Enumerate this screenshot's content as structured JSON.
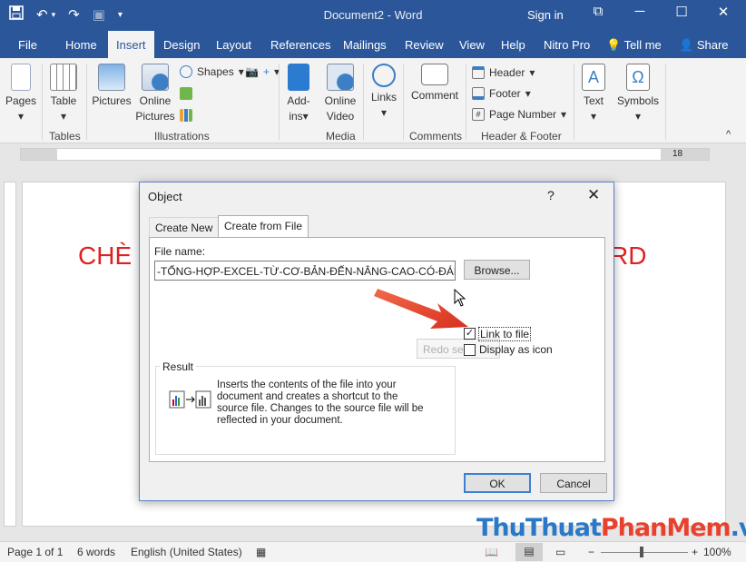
{
  "titlebar": {
    "title": "Document2 - Word",
    "sign_in": "Sign in"
  },
  "tabs": {
    "items": [
      "File",
      "Home",
      "Insert",
      "Design",
      "Layout",
      "References",
      "Mailings",
      "Review",
      "View",
      "Help",
      "Nitro Pro"
    ],
    "active": "Insert",
    "tell_me": "Tell me",
    "share": "Share"
  },
  "ribbon": {
    "pages": "Pages",
    "table": "Table",
    "pictures": "Pictures",
    "online_pictures_1": "Online",
    "online_pictures_2": "Pictures",
    "shapes": "Shapes",
    "addins_1": "Add-",
    "addins_2": "ins",
    "online_video_1": "Online",
    "online_video_2": "Video",
    "links": "Links",
    "comment": "Comment",
    "header": "Header",
    "footer": "Footer",
    "page_number": "Page Number",
    "text": "Text",
    "symbols": "Symbols",
    "groups": {
      "tables": "Tables",
      "illustrations": "Illustrations",
      "media": "Media",
      "comments": "Comments",
      "header_footer": "Header & Footer"
    }
  },
  "ruler": {
    "label": "18"
  },
  "document": {
    "heading_left": "CHÈ",
    "heading_right": "RD"
  },
  "dialog": {
    "title": "Object",
    "help": "?",
    "tab_create_new": "Create New",
    "tab_create_from_file": "Create from File",
    "file_name_label": "File name:",
    "file_name_value": "-TỔNG-HỢP-EXCEL-TỪ-CƠ-BẢN-ĐẾN-NÂNG-CAO-CÓ-ĐÁP-ÁN.xls",
    "browse": "Browse...",
    "ghost_text": "Redo se",
    "link_to_file": "Link to file",
    "link_to_file_checked": true,
    "display_as_icon": "Display as icon",
    "result_label": "Result",
    "result_text": "Inserts the contents of the file into your document and creates a shortcut to the source file.  Changes to the source file will be reflected in your document.",
    "ok": "OK",
    "cancel": "Cancel"
  },
  "statusbar": {
    "page": "Page 1 of 1",
    "words": "6 words",
    "language": "English (United States)",
    "zoom": "100%"
  },
  "watermark": {
    "part1": "Thu",
    "part2": "Thuat",
    "part3": "Phan",
    "part4": "Mem",
    "part5": ".vn"
  },
  "colors": {
    "word_blue": "#2b579a",
    "heading_red": "#e02020",
    "arrow_red": "#e8412e"
  }
}
